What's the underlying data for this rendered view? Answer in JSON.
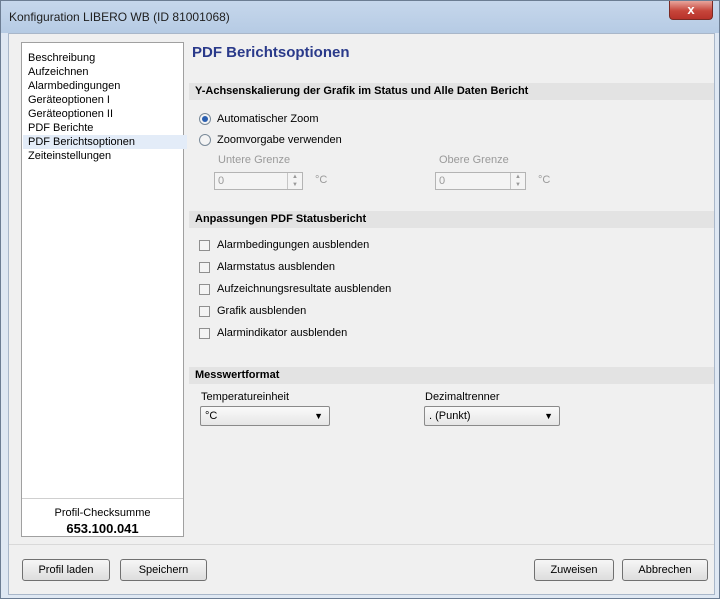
{
  "window": {
    "title": "Konfiguration LIBERO WB (ID 81001068)",
    "close_label": "x"
  },
  "sidebar": {
    "items": [
      {
        "label": "Beschreibung"
      },
      {
        "label": "Aufzeichnen"
      },
      {
        "label": "Alarmbedingungen"
      },
      {
        "label": "Geräteoptionen I"
      },
      {
        "label": "Geräteoptionen II"
      },
      {
        "label": "PDF Berichte"
      },
      {
        "label": "PDF Berichtsoptionen"
      },
      {
        "label": "Zeiteinstellungen"
      }
    ],
    "selected": "PDF Berichtsoptionen",
    "checksum_label": "Profil-Checksumme",
    "checksum_value": "653.100.041"
  },
  "main": {
    "title": "PDF Berichtsoptionen",
    "y_section": {
      "heading": "Y-Achsenskalierung der Grafik im Status und Alle Daten Bericht",
      "option_auto": "Automatischer Zoom",
      "option_manual": "Zoomvorgabe verwenden",
      "selected": "Automatischer Zoom",
      "lower_label": "Untere Grenze",
      "lower_value": "0",
      "upper_label": "Obere Grenze",
      "upper_value": "0",
      "unit": "°C"
    },
    "status_section": {
      "heading": "Anpassungen PDF Statusbericht",
      "options": [
        {
          "label": "Alarmbedingungen ausblenden",
          "checked": false
        },
        {
          "label": "Alarmstatus ausblenden",
          "checked": false
        },
        {
          "label": "Aufzeichnungsresultate ausblenden",
          "checked": false
        },
        {
          "label": "Grafik ausblenden",
          "checked": false
        },
        {
          "label": "Alarmindikator ausblenden",
          "checked": false
        }
      ]
    },
    "format_section": {
      "heading": "Messwertformat",
      "temp_label": "Temperatureinheit",
      "temp_value": "°C",
      "decimal_label": "Dezimaltrenner",
      "decimal_value": ". (Punkt)"
    }
  },
  "footer": {
    "load_label": "Profil laden",
    "save_label": "Speichern",
    "assign_label": "Zuweisen",
    "cancel_label": "Abbrechen"
  }
}
